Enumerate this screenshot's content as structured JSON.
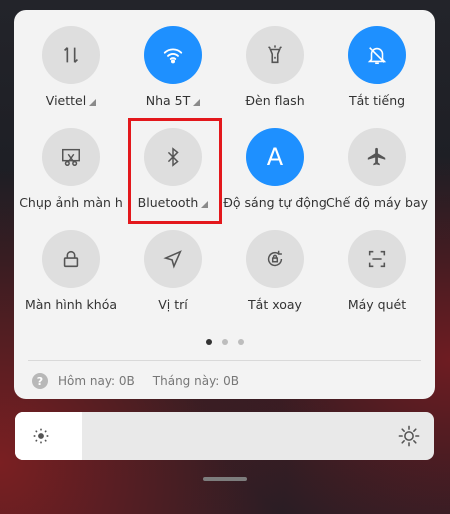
{
  "tiles": [
    {
      "id": "mobile-data",
      "label": "Viettel",
      "caret": true,
      "active": false,
      "icon": "mobile-data-arrows-icon"
    },
    {
      "id": "wifi",
      "label": "Nha 5T",
      "caret": true,
      "active": true,
      "icon": "wifi-icon"
    },
    {
      "id": "flashlight",
      "label": "Đèn flash",
      "caret": false,
      "active": false,
      "icon": "flashlight-icon"
    },
    {
      "id": "silent",
      "label": "Tắt tiếng",
      "caret": false,
      "active": true,
      "icon": "bell-off-icon"
    },
    {
      "id": "screenshot",
      "label": "Chụp ảnh màn h",
      "caret": false,
      "active": false,
      "icon": "screenshot-scissors-icon"
    },
    {
      "id": "bluetooth",
      "label": "Bluetooth",
      "caret": true,
      "active": false,
      "icon": "bluetooth-icon"
    },
    {
      "id": "auto-brightness",
      "label": "Độ sáng tự động",
      "caret": false,
      "active": true,
      "icon": "auto-brightness-letter-a-icon",
      "glyph": "A"
    },
    {
      "id": "airplane",
      "label": "Chế độ máy bay",
      "caret": false,
      "active": false,
      "icon": "airplane-icon"
    },
    {
      "id": "lock-screen",
      "label": "Màn hình khóa",
      "caret": false,
      "active": false,
      "icon": "lock-icon"
    },
    {
      "id": "location",
      "label": "Vị trí",
      "caret": false,
      "active": false,
      "icon": "location-arrow-icon"
    },
    {
      "id": "auto-rotate",
      "label": "Tắt xoay",
      "caret": false,
      "active": false,
      "icon": "rotation-lock-icon"
    },
    {
      "id": "scanner",
      "label": "Máy quét",
      "caret": false,
      "active": false,
      "icon": "scan-frame-icon"
    }
  ],
  "pager": {
    "pages": 3,
    "current": 0
  },
  "usage": {
    "help_icon": "?",
    "today": "Hôm nay: 0B",
    "month": "Tháng này: 0B"
  },
  "brightness": {
    "level": 0.16,
    "low_icon": "sun-small-icon",
    "high_icon": "sun-large-icon"
  },
  "colors": {
    "accent": "#1e90ff",
    "highlight": "#e3171b",
    "tile_off": "#dedede"
  }
}
